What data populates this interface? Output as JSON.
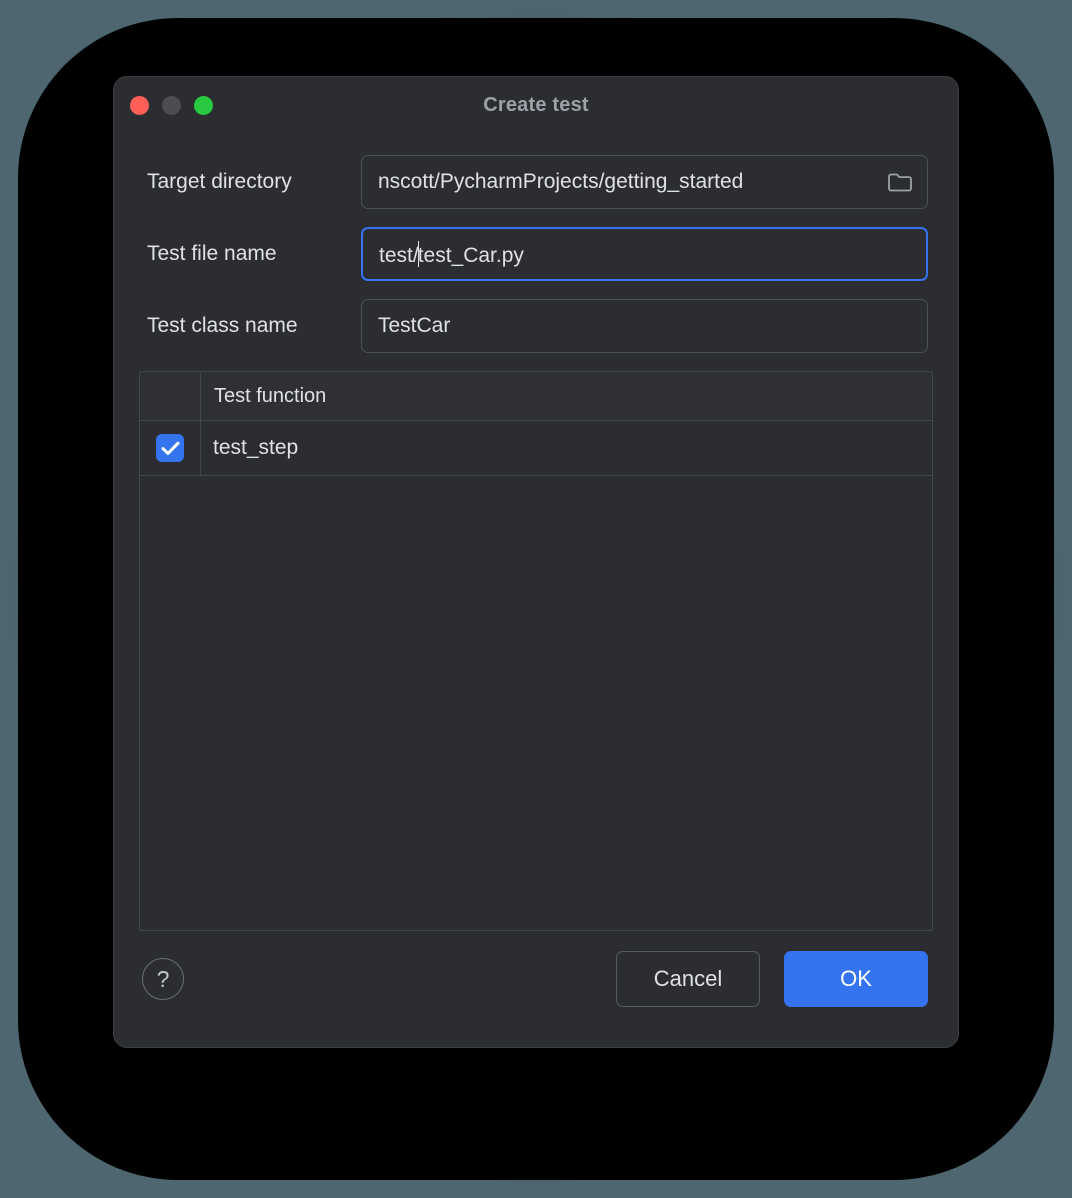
{
  "window": {
    "title": "Create test",
    "traffic_lights": [
      {
        "name": "close-button",
        "color": "#ff5f56"
      },
      {
        "name": "minimize-button",
        "color": "#4b4d50"
      },
      {
        "name": "maximize-button",
        "color": "#28c840"
      }
    ]
  },
  "form": {
    "target_directory": {
      "label": "Target directory",
      "value": "nscott/PycharmProjects/getting_started",
      "icon": "folder-icon"
    },
    "test_file_name": {
      "label": "Test file name",
      "value_before_caret": "test/",
      "value_after_caret": "test_Car.py",
      "value": "test/test_Car.py",
      "focused": true
    },
    "test_class_name": {
      "label": "Test class name",
      "value": "TestCar"
    }
  },
  "table": {
    "columns": [
      "",
      "Test function"
    ],
    "rows": [
      {
        "checked": true,
        "name": "test_step"
      }
    ]
  },
  "footer": {
    "help_label": "?",
    "cancel_label": "Cancel",
    "ok_label": "OK"
  },
  "colors": {
    "accent": "#3574f0",
    "dialog_bg": "#2b2d30",
    "border": "#4d5054",
    "text": "#dfe1e5",
    "title_text": "#9da1a8",
    "backdrop": "#4e6670"
  }
}
